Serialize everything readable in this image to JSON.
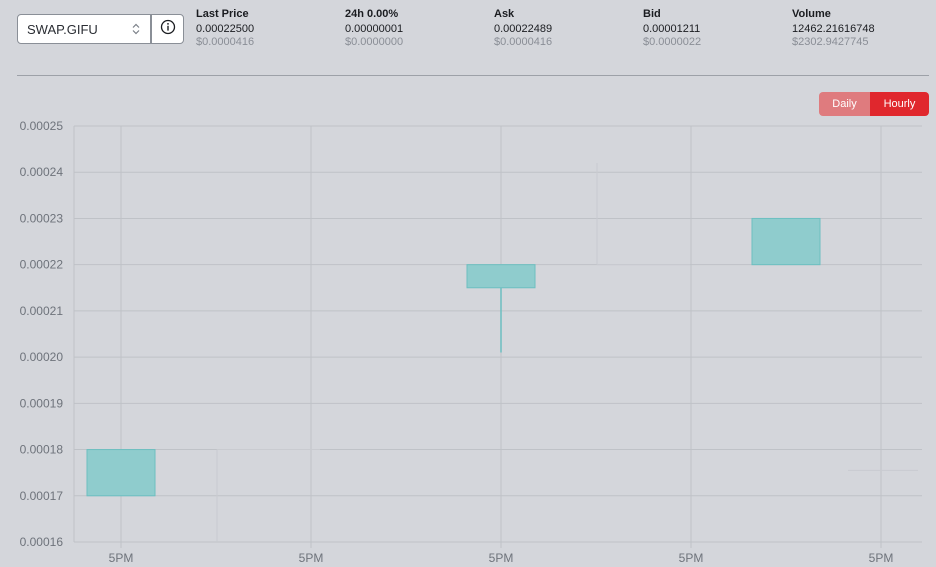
{
  "header": {
    "pair": "SWAP.GIFU",
    "stats": [
      {
        "label": "Last Price",
        "value": "0.00022500",
        "usd": "$0.0000416"
      },
      {
        "label": "24h 0.00%",
        "value": "0.00000001",
        "usd": "$0.0000000"
      },
      {
        "label": "Ask",
        "value": "0.00022489",
        "usd": "$0.0000416"
      },
      {
        "label": "Bid",
        "value": "0.00001211",
        "usd": "$0.0000022"
      },
      {
        "label": "Volume",
        "value": "12462.21616748",
        "usd": "$2302.9427745"
      }
    ]
  },
  "toggle": {
    "daily": "Daily",
    "hourly": "Hourly",
    "active": "Hourly"
  },
  "colors": {
    "candle_fill": "#8fcccd",
    "candle_stroke": "#6cbfc0",
    "active_toggle": "#e0272d",
    "inactive_toggle": "#df7b7e"
  },
  "icons": {
    "info": "info-circle-icon",
    "select": "chevron-updown-icon"
  },
  "chart_data": {
    "type": "candlestick",
    "ylim": [
      0.00016,
      0.00025
    ],
    "yticks": [
      "0.00025",
      "0.00024",
      "0.00023",
      "0.00022",
      "0.00021",
      "0.00020",
      "0.00019",
      "0.00018",
      "0.00017",
      "0.00016"
    ],
    "xticks": [
      "5PM",
      "5PM",
      "5PM",
      "5PM",
      "5PM"
    ],
    "grid": true,
    "candles": [
      {
        "open": 0.00017,
        "close": 0.00018,
        "high": 0.00018,
        "low": 0.00017
      },
      {
        "open": 0.000215,
        "close": 0.00022,
        "high": 0.00022,
        "low": 0.000201
      },
      {
        "open": 0.00022,
        "close": 0.00023,
        "high": 0.00023,
        "low": 0.00022
      }
    ]
  }
}
